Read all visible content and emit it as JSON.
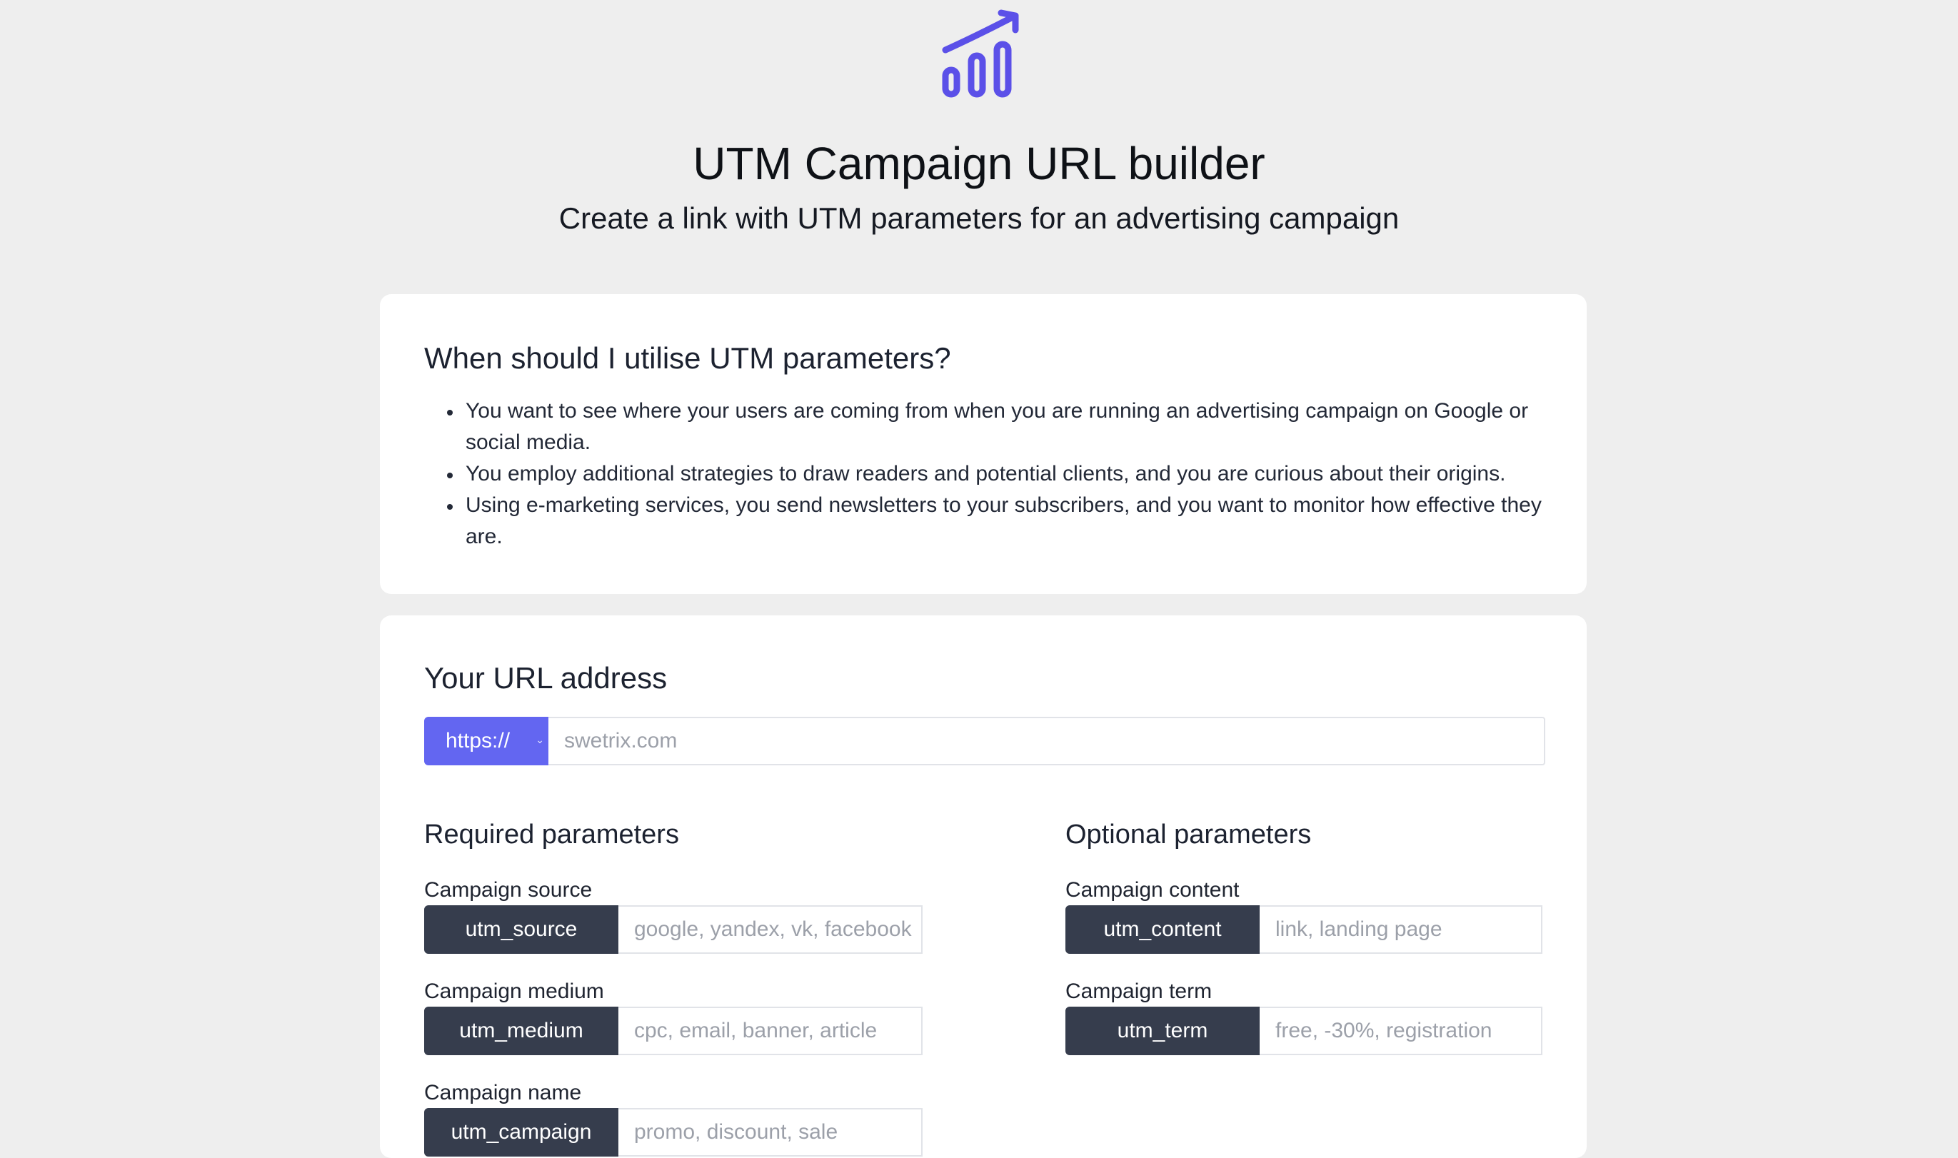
{
  "header": {
    "logo_icon": "growth-chart-icon",
    "title": "UTM Campaign URL builder",
    "subtitle": "Create a link with UTM parameters for an advertising campaign"
  },
  "colors": {
    "accent": "#6366f1",
    "tag_bg": "#363d4d",
    "page_bg": "#eeeeee"
  },
  "info_card": {
    "heading": "When should I utilise UTM parameters?",
    "bullets": [
      "You want to see where your users are coming from when you are running an advertising campaign on Google or social media.",
      "You employ additional strategies to draw readers and potential clients, and you are curious about their origins.",
      "Using e-marketing services, you send newsletters to your subscribers, and you want to monitor how effective they are."
    ]
  },
  "url_card": {
    "heading": "Your URL address",
    "protocol": "https://",
    "url_placeholder": "swetrix.com"
  },
  "required": {
    "title": "Required parameters",
    "fields": [
      {
        "label": "Campaign source",
        "tag": "utm_source",
        "placeholder": "google, yandex, vk, facebook"
      },
      {
        "label": "Campaign medium",
        "tag": "utm_medium",
        "placeholder": "cpc, email, banner, article"
      },
      {
        "label": "Campaign name",
        "tag": "utm_campaign",
        "placeholder": "promo, discount, sale"
      }
    ]
  },
  "optional": {
    "title": "Optional parameters",
    "fields": [
      {
        "label": "Campaign content",
        "tag": "utm_content",
        "placeholder": "link, landing page"
      },
      {
        "label": "Campaign term",
        "tag": "utm_term",
        "placeholder": "free, -30%, registration"
      }
    ]
  }
}
